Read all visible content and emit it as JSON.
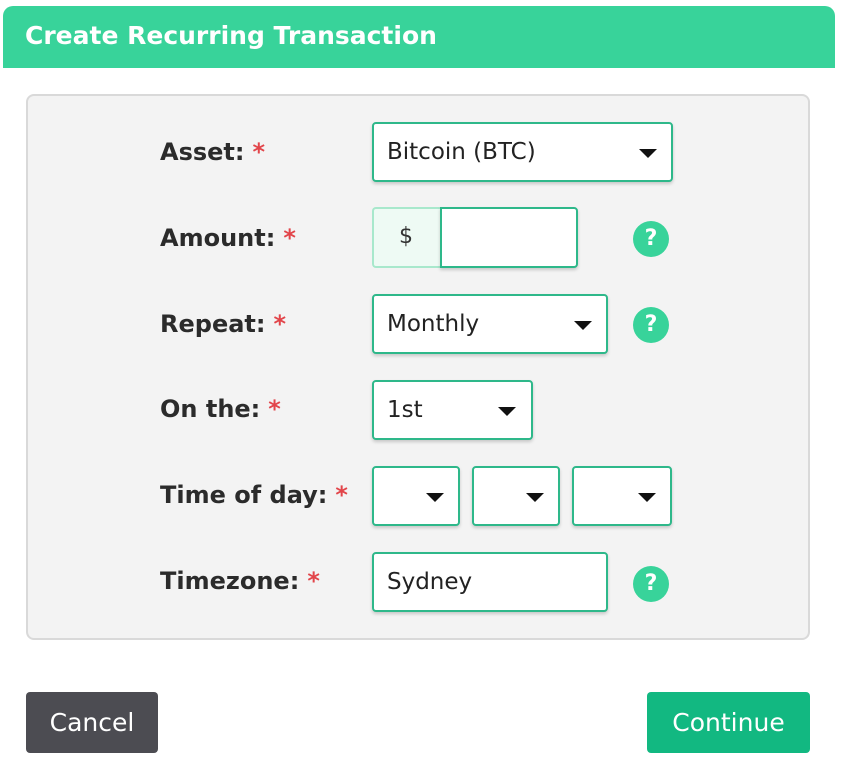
{
  "header": {
    "title": "Create Recurring Transaction"
  },
  "form": {
    "required_mark": "*",
    "asset": {
      "label": "Asset:",
      "value": "Bitcoin (BTC)"
    },
    "amount": {
      "label": "Amount:",
      "prefix": "$",
      "value": ""
    },
    "repeat": {
      "label": "Repeat:",
      "value": "Monthly"
    },
    "on_the": {
      "label": "On the:",
      "value": "1st"
    },
    "time_of_day": {
      "label": "Time of day:",
      "hour": "",
      "minute": "",
      "ampm": ""
    },
    "timezone": {
      "label": "Timezone:",
      "value": "Sydney"
    },
    "help_glyph": "?"
  },
  "buttons": {
    "cancel": "Cancel",
    "continue": "Continue"
  },
  "colors": {
    "header_bg": "#38d39a",
    "accent_border": "#2eb88a",
    "required": "#e2454a",
    "cancel_bg": "#4c4c52",
    "continue_bg": "#12b881"
  },
  "icons": {
    "dropdown": "caret-down-icon",
    "help": "help-icon"
  }
}
